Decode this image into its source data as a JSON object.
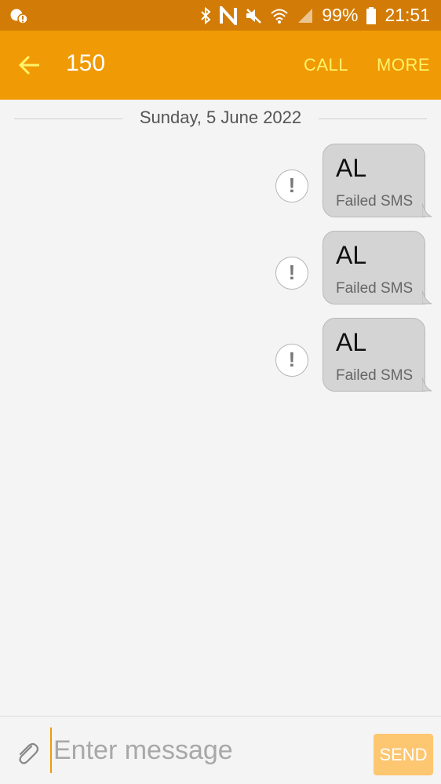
{
  "status_bar": {
    "icons": [
      "notification-icon",
      "bluetooth-icon",
      "nfc-icon",
      "mute-icon",
      "wifi-icon",
      "signal-icon",
      "battery-icon"
    ],
    "battery": "99%",
    "time": "21:51"
  },
  "app_bar": {
    "back_icon": "arrow-left-icon",
    "title": "150",
    "call_label": "CALL",
    "more_label": "MORE"
  },
  "conversation": {
    "date": "Sunday, 5 June 2022",
    "messages": [
      {
        "text": "AL",
        "status": "Failed SMS",
        "indicator": "exclamation-icon"
      },
      {
        "text": "AL",
        "status": "Failed SMS",
        "indicator": "exclamation-icon"
      },
      {
        "text": "AL",
        "status": "Failed SMS",
        "indicator": "exclamation-icon"
      }
    ]
  },
  "composer": {
    "attach_icon": "paperclip-icon",
    "placeholder": "Enter message",
    "value": "",
    "send_label": "SEND"
  },
  "colors": {
    "status_bar": "#d27c07",
    "app_bar": "#f09a05",
    "action_text": "#fff36a",
    "bubble": "#d4d4d4",
    "send_button": "#fdc671"
  }
}
